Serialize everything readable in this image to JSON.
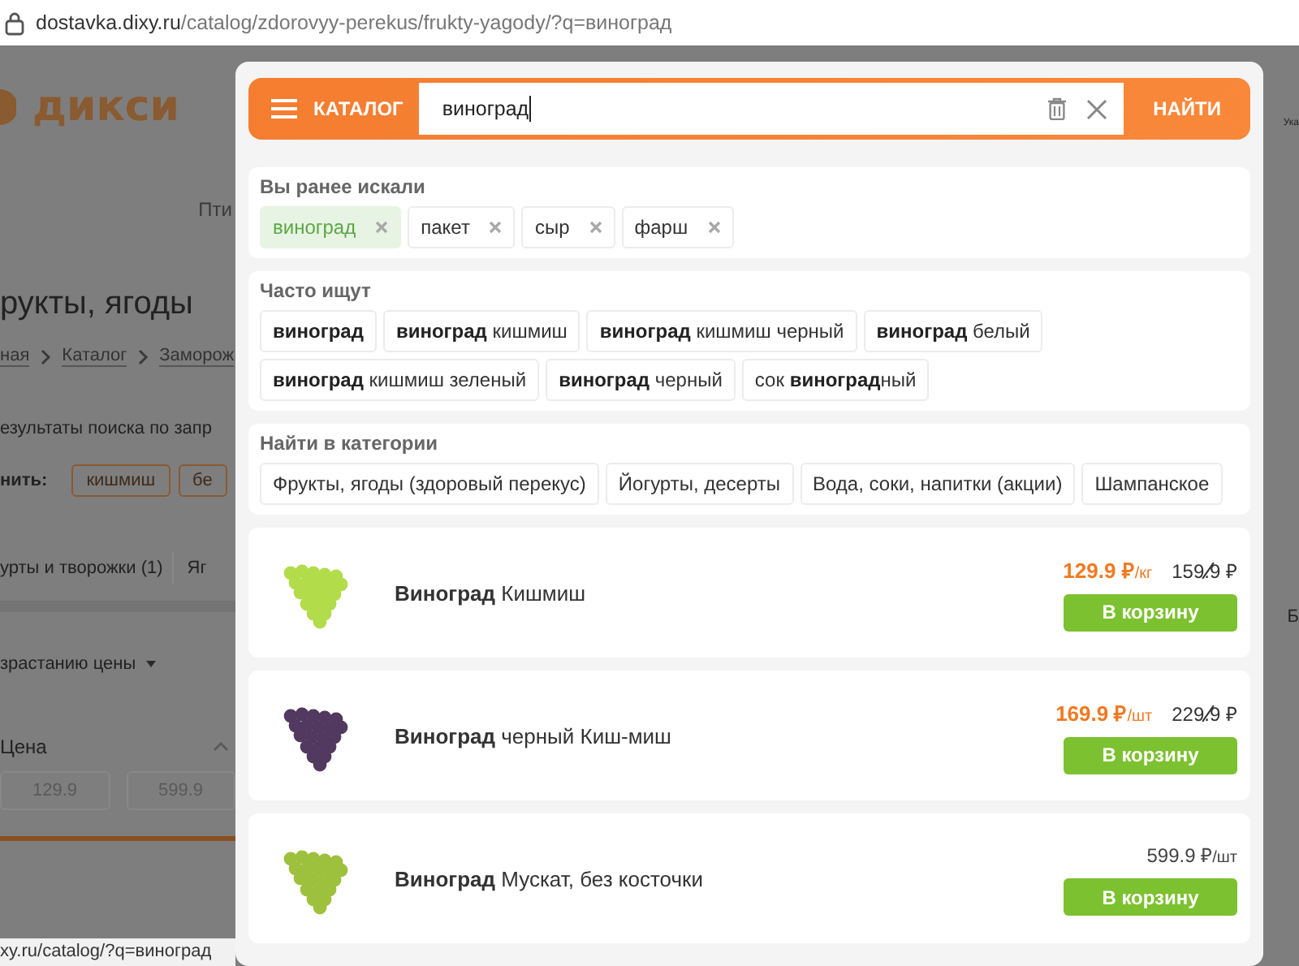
{
  "browser": {
    "url_domain": "dostavka.dixy.ru",
    "url_path": "/catalog/zdorovyy-perekus/frukty-yagody/?q=виноград",
    "status_url": "xy.ru/catalog/?q=виноград"
  },
  "page": {
    "logo": "дикси",
    "nav_fragment": "Пти",
    "heading": "рукты, ягоды",
    "breadcrumbs": [
      "ная",
      "Каталог",
      "Заморож"
    ],
    "results_text": "езультаты поиска по запр",
    "refine_label": "нить:",
    "refine_chips": [
      "кишмиш",
      "бе"
    ],
    "category_chips": [
      "урты и творожки (1)",
      "Яг"
    ],
    "sort": "зрастанию цены",
    "price_filter": {
      "title": "Цена",
      "from": "129.9",
      "to": "599.9"
    },
    "right_edge": [
      "Ука",
      "Б"
    ]
  },
  "search": {
    "catalog_button": "КАТАЛОГ",
    "value": "виноград",
    "submit": "НАЙТИ"
  },
  "history": {
    "title": "Вы ранее искали",
    "items": [
      {
        "label": "виноград",
        "selected": true
      },
      {
        "label": "пакет",
        "selected": false
      },
      {
        "label": "сыр",
        "selected": false
      },
      {
        "label": "фарш",
        "selected": false
      }
    ]
  },
  "popular": {
    "title": "Часто ищут",
    "items": [
      "**виноград**",
      "**виноград** кишмиш",
      "**виноград** кишмиш черный",
      "**виноград** белый",
      "**виноград** кишмиш зеленый",
      "**виноград** черный",
      "сок **виноград**ный"
    ]
  },
  "categories": {
    "title": "Найти в категории",
    "items": [
      "Фрукты, ягоды (здоровый перекус)",
      "Йогурты, десерты",
      "Вода, соки, напитки (акции)",
      "Шампанское"
    ]
  },
  "products": [
    {
      "name": "**Виноград** Кишмиш",
      "price": "129.9 ₽",
      "unit": "/кг",
      "old_price": "159.9 ₽",
      "discount": true,
      "color": "#b2dc4a",
      "button": "В корзину"
    },
    {
      "name": "**Виноград** черный Киш-миш",
      "price": "169.9 ₽",
      "unit": "/шт",
      "old_price": "229.9 ₽",
      "discount": true,
      "color": "#52395f",
      "button": "В корзину"
    },
    {
      "name": "**Виноград** Мускат, без косточки",
      "price": "599.9 ₽",
      "unit": "/шт",
      "discount": false,
      "color": "#9dc13c",
      "button": "В корзину"
    }
  ]
}
